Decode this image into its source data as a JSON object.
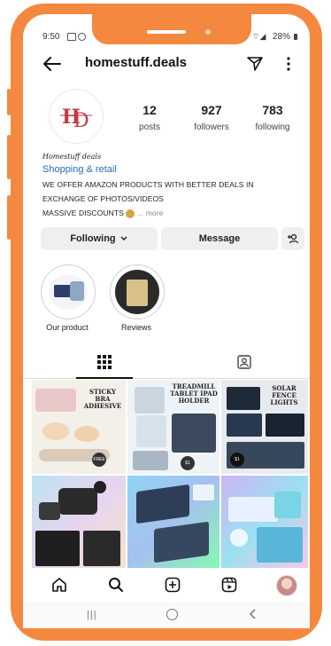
{
  "status_bar": {
    "time": "9:50",
    "battery": "28%"
  },
  "header": {
    "username": "homestuff.deals",
    "back_icon": "back-arrow-icon",
    "send_icon": "send-icon",
    "more_icon": "more-vertical-icon"
  },
  "profile": {
    "stats": [
      {
        "value": "12",
        "label": "posts"
      },
      {
        "value": "927",
        "label": "followers"
      },
      {
        "value": "783",
        "label": "following"
      }
    ],
    "bio": {
      "name": "Homestuff deals",
      "category": "Shopping & retail",
      "line1": "WE OFFER AMAZON PRODUCTS WITH BETTER DEALS IN",
      "line2": "EXCHANGE OF PHOTOS/VIDEOS",
      "line3": "MASSIVE DISCOUNTS",
      "more": "... more"
    }
  },
  "actions": {
    "following": "Following",
    "message": "Message",
    "add_person_icon": "add-person-icon"
  },
  "highlights": [
    {
      "label": "Our product"
    },
    {
      "label": "Reviews"
    }
  ],
  "tabs": {
    "grid_icon": "grid-icon",
    "tagged_icon": "tagged-person-icon"
  },
  "posts": [
    {
      "title": "STICKY BRA ADHESIVE",
      "badge": "FREE"
    },
    {
      "title": "TREADMILL TABLET IPAD HOLDER",
      "badge": "$1"
    },
    {
      "title": "SOLAR FENCE LIGHTS",
      "badge": "$1"
    },
    {
      "title": "",
      "badge": ""
    },
    {
      "title": "",
      "badge": ""
    },
    {
      "title": "",
      "badge": ""
    }
  ],
  "bottom_nav": [
    "home-icon",
    "search-icon",
    "create-icon",
    "reels-icon",
    "profile-avatar-icon"
  ],
  "colors": {
    "frame": "#f5883f",
    "link": "#2b6cb0",
    "logo": "#c43a44"
  }
}
